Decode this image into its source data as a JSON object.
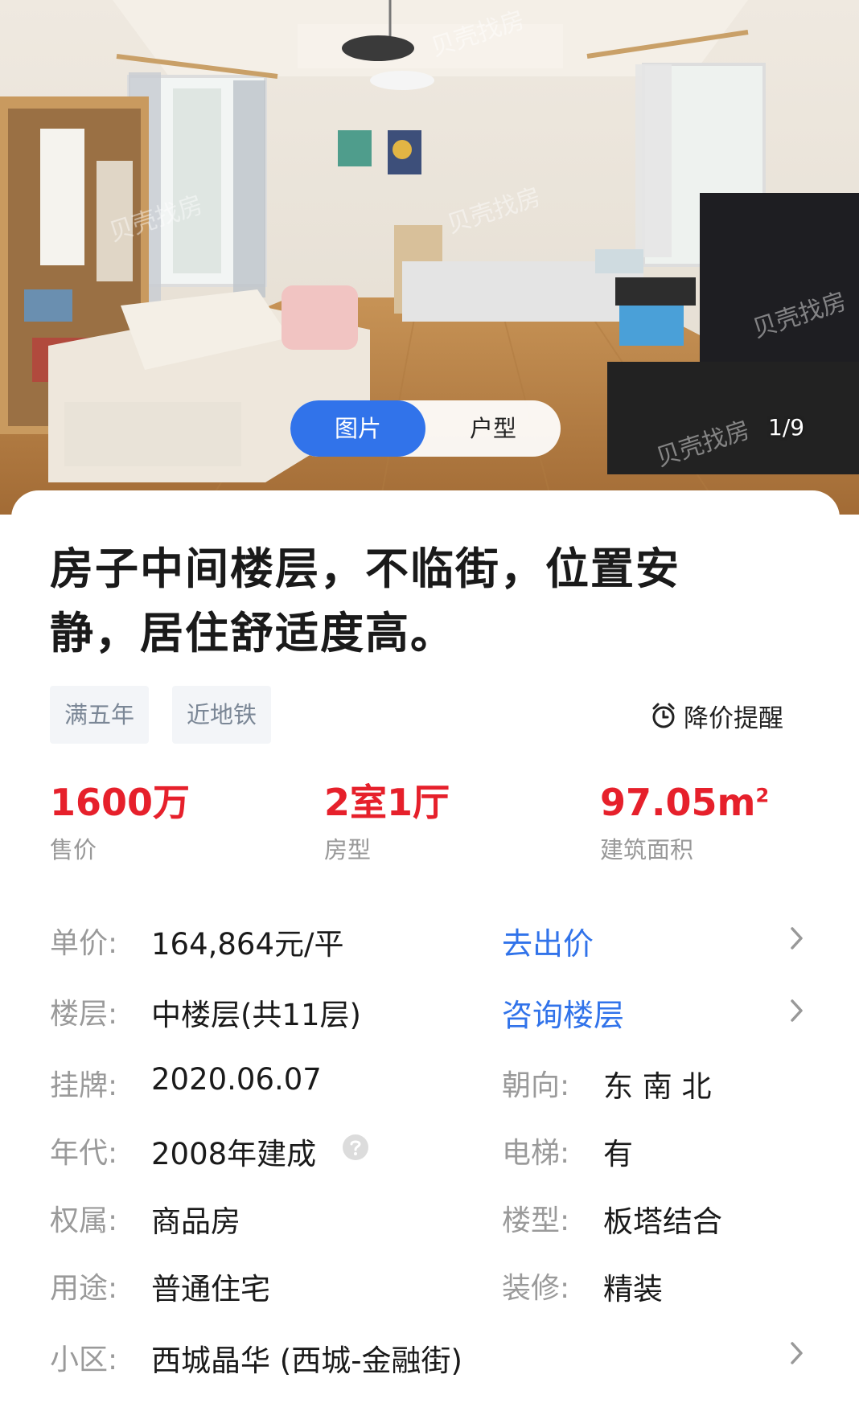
{
  "gallery": {
    "tabs": [
      {
        "label": "图片",
        "active": true
      },
      {
        "label": "户型",
        "active": false
      }
    ],
    "counter": "1/9",
    "watermark": "贝壳找房"
  },
  "listing": {
    "title": "房子中间楼层，不临街，位置安静，居住舒适度高。",
    "tags": [
      "满五年",
      "近地铁"
    ],
    "price_alert": {
      "icon": "alarm-clock-icon",
      "label": "降价提醒"
    },
    "stats": [
      {
        "value": "1600万",
        "label": "售价"
      },
      {
        "value": "2室1厅",
        "label": "房型"
      },
      {
        "value": "97.05m",
        "sup": "2",
        "label": "建筑面积"
      }
    ],
    "details": {
      "unit_price": {
        "label": "单价:",
        "value": "164,864元/平",
        "link": "去出价"
      },
      "floor": {
        "label": "楼层:",
        "value": "中楼层(共11层)",
        "link": "咨询楼层"
      },
      "listed": {
        "label": "挂牌:",
        "value": "2020.06.07"
      },
      "orientation": {
        "label": "朝向:",
        "value": "东 南 北"
      },
      "year": {
        "label": "年代:",
        "value": "2008年建成"
      },
      "elevator": {
        "label": "电梯:",
        "value": "有"
      },
      "ownership": {
        "label": "权属:",
        "value": "商品房"
      },
      "building_type": {
        "label": "楼型:",
        "value": "板塔结合"
      },
      "usage": {
        "label": "用途:",
        "value": "普通住宅"
      },
      "decoration": {
        "label": "装修:",
        "value": "精装"
      },
      "community": {
        "label": "小区:",
        "value": "西城晶华 (西城-金融街)"
      }
    }
  },
  "colors": {
    "accent": "#3173ea",
    "price": "#e6202b",
    "label": "#9a9a9a"
  }
}
